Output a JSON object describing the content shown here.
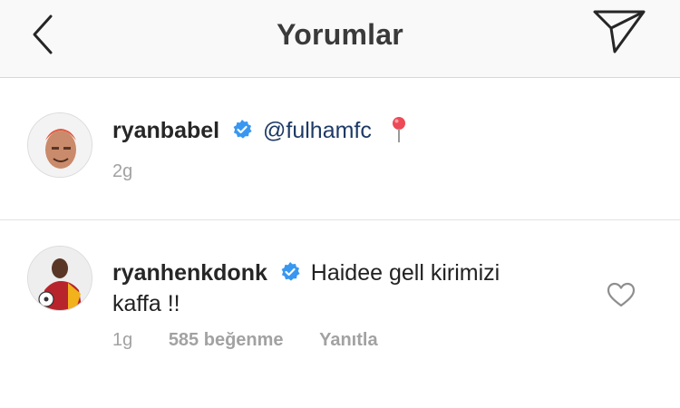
{
  "header": {
    "title": "Yorumlar",
    "back_icon": "chevron-left-icon",
    "send_icon": "send-direct-icon"
  },
  "caption": {
    "username": "ryanbabel",
    "verified_icon": "verified-badge-icon",
    "mention": "@fulhamfc",
    "pin_icon": "pin-icon",
    "time": "2g"
  },
  "comment": {
    "username": "ryanhenkdonk",
    "verified_icon": "verified-badge-icon",
    "text_line1": "Haidee gell kirimizi",
    "text_line2": "kaffa !!",
    "time": "1g",
    "likes": "585 beğenme",
    "reply_label": "Yanıtla",
    "like_icon": "heart-icon"
  },
  "colors": {
    "verified_blue": "#3897f0",
    "pin_red": "#ed4956",
    "secondary_text": "#a2a2a2",
    "header_bg": "#f9f9f9"
  }
}
